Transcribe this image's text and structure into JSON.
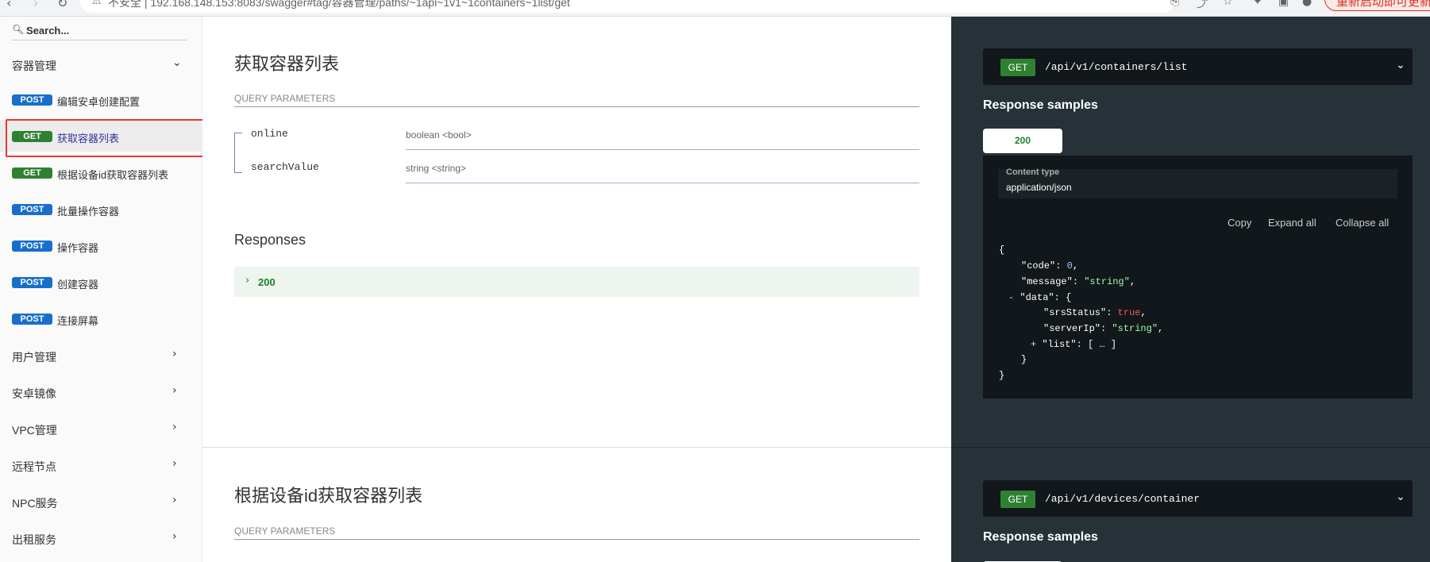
{
  "browser": {
    "url_security": "不安全",
    "url": "192.168.148.153:8083/swagger#tag/容器管理/paths/~1api~1v1~1containers~1list/get",
    "restart_label": "重新启动即可更新"
  },
  "sidebar": {
    "search_placeholder": "Search...",
    "groups": [
      {
        "label": "容器管理",
        "expanded": true
      },
      {
        "label": "用户管理"
      },
      {
        "label": "安卓镜像"
      },
      {
        "label": "VPC管理"
      },
      {
        "label": "远程节点"
      },
      {
        "label": "NPC服务"
      },
      {
        "label": "出租服务"
      }
    ],
    "operations": [
      {
        "method": "POST",
        "label": "编辑安卓创建配置"
      },
      {
        "method": "GET",
        "label": "获取容器列表",
        "active": true
      },
      {
        "method": "GET",
        "label": "根据设备id获取容器列表"
      },
      {
        "method": "POST",
        "label": "批量操作容器"
      },
      {
        "method": "POST",
        "label": "操作容器"
      },
      {
        "method": "POST",
        "label": "创建容器"
      },
      {
        "method": "POST",
        "label": "连接屏幕"
      }
    ]
  },
  "main": {
    "section1": {
      "title": "获取容器列表",
      "query_params_label": "QUERY PARAMETERS",
      "params": [
        {
          "name": "online",
          "type": "boolean <bool>"
        },
        {
          "name": "searchValue",
          "type": "string <string>"
        }
      ],
      "responses_label": "Responses",
      "response_code": "200"
    },
    "section2": {
      "title": "根据设备id获取容器列表",
      "query_params_label": "QUERY PARAMETERS"
    }
  },
  "right": {
    "endpoint1": {
      "method": "GET",
      "path": "/api/v1/containers/list"
    },
    "response_samples_label": "Response samples",
    "status_tab": "200",
    "content_type_label": "Content type",
    "content_type_value": "application/json",
    "copy_label": "Copy",
    "expand_label": "Expand all",
    "collapse_label": "Collapse all",
    "json": {
      "open_brace": "{",
      "code_key": "\"code\"",
      "code_val": "0",
      "message_key": "\"message\"",
      "message_val": "\"string\"",
      "data_toggle": "-",
      "data_key": "\"data\"",
      "srs_key": "\"srsStatus\"",
      "srs_val": "true",
      "server_key": "\"serverIp\"",
      "server_val": "\"string\"",
      "list_toggle": "+",
      "list_key": "\"list\"",
      "list_val": "[ … ]",
      "close_inner": "}",
      "close_outer": "}"
    },
    "endpoint2": {
      "method": "GET",
      "path": "/api/v1/devices/container"
    },
    "response_samples_label2": "Response samples"
  }
}
